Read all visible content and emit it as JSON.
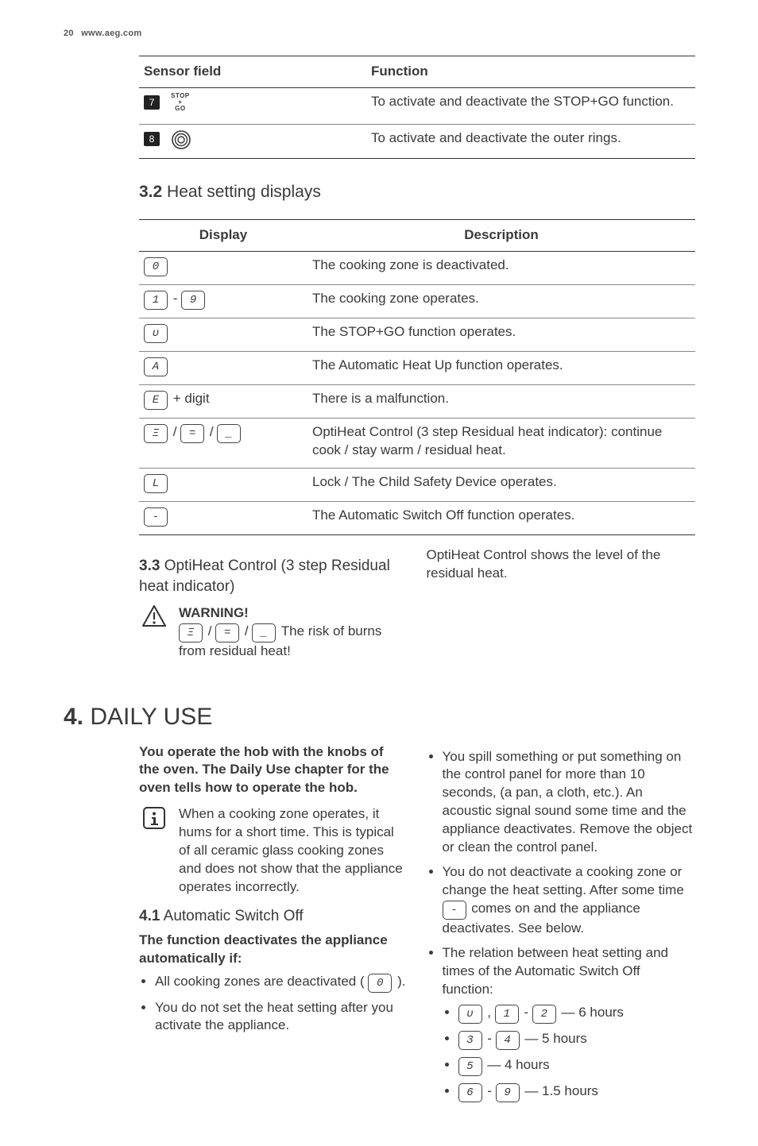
{
  "header": {
    "page_number": "20",
    "site": "www.aeg.com"
  },
  "sensor_table": {
    "col1": "Sensor field",
    "col2": "Function",
    "rows": [
      {
        "num": "7",
        "icon": "stop-go",
        "icon_text": "STOP\n+\nGO",
        "desc": "To activate and deactivate the STOP+GO function."
      },
      {
        "num": "8",
        "icon": "outer-ring",
        "desc": "To activate and deactivate the outer rings."
      }
    ]
  },
  "sec32": {
    "heading_num": "3.2",
    "heading_txt": "Heat setting displays",
    "col1": "Display",
    "col2": "Description",
    "rows": [
      {
        "disp": [
          {
            "t": "seg",
            "v": "0"
          }
        ],
        "desc": "The cooking zone is deactivated."
      },
      {
        "disp": [
          {
            "t": "seg",
            "v": "1"
          },
          {
            "t": "txt",
            "v": " - "
          },
          {
            "t": "seg",
            "v": "9"
          }
        ],
        "desc": "The cooking zone operates."
      },
      {
        "disp": [
          {
            "t": "seg",
            "v": "υ"
          }
        ],
        "desc": "The STOP+GO function operates."
      },
      {
        "disp": [
          {
            "t": "seg",
            "v": "A"
          }
        ],
        "desc": "The Automatic Heat Up function operates."
      },
      {
        "disp": [
          {
            "t": "seg",
            "v": "E"
          },
          {
            "t": "txt",
            "v": " + digit"
          }
        ],
        "desc": "There is a malfunction."
      },
      {
        "disp": [
          {
            "t": "seg",
            "v": "Ξ"
          },
          {
            "t": "txt",
            "v": " / "
          },
          {
            "t": "seg",
            "v": "="
          },
          {
            "t": "txt",
            "v": " / "
          },
          {
            "t": "seg",
            "v": "_"
          }
        ],
        "desc": "OptiHeat Control (3 step Residual heat indicator): continue cook / stay warm / residual heat."
      },
      {
        "disp": [
          {
            "t": "seg",
            "v": "L"
          }
        ],
        "desc": "Lock / The Child Safety Device operates."
      },
      {
        "disp": [
          {
            "t": "seg",
            "v": "-"
          }
        ],
        "desc": "The Automatic Switch Off function operates."
      }
    ]
  },
  "sec33": {
    "heading_num": "3.3",
    "heading_txt": "OptiHeat Control (3 step Residual heat indicator)",
    "warn_title": "WARNING!",
    "warn_segs": [
      {
        "t": "seg",
        "v": "Ξ"
      },
      {
        "t": "txt",
        "v": " / "
      },
      {
        "t": "seg",
        "v": "="
      },
      {
        "t": "txt",
        "v": " / "
      },
      {
        "t": "seg",
        "v": "_"
      }
    ],
    "warn_txt": " The risk of burns from residual heat!",
    "right_txt": "OptiHeat Control shows the level of the residual heat."
  },
  "chap4": {
    "num": "4.",
    "title": "DAILY USE",
    "intro": "You operate the hob with the knobs of the oven. The Daily Use chapter for the oven tells how to operate the hob.",
    "info_txt": "When a cooking zone operates, it hums for a short time. This is typical of all ceramic glass cooking zones and does not show that the appliance operates incorrectly.",
    "sec41": {
      "num": "4.1",
      "title": "Automatic Switch Off",
      "lead": "The function deactivates the appliance automatically if:",
      "left_items": [
        {
          "pre": "All cooking zones are deactivated ( ",
          "seg": "0",
          "post": " )."
        },
        {
          "txt": "You do not set the heat setting after you activate the appliance."
        }
      ],
      "right_items": [
        {
          "txt": "You spill something or put something on the control panel for more than 10 seconds, (a pan, a cloth, etc.). An acoustic signal sound some time and the appliance deactivates. Remove the object or clean the control panel."
        },
        {
          "pre": "You do not deactivate a cooking zone or change the heat setting. After some time ",
          "seg": "-",
          "post": " comes on and the appliance deactivates. See below."
        },
        {
          "txt": "The relation between heat setting and times of the Automatic Switch Off function:",
          "sub": [
            {
              "parts": [
                {
                  "t": "seg",
                  "v": "υ"
                },
                {
                  "t": "txt",
                  "v": " , "
                },
                {
                  "t": "seg",
                  "v": "1"
                },
                {
                  "t": "txt",
                  "v": " - "
                },
                {
                  "t": "seg",
                  "v": "2"
                },
                {
                  "t": "txt",
                  "v": " — 6 hours"
                }
              ]
            },
            {
              "parts": [
                {
                  "t": "seg",
                  "v": "3"
                },
                {
                  "t": "txt",
                  "v": " - "
                },
                {
                  "t": "seg",
                  "v": "4"
                },
                {
                  "t": "txt",
                  "v": " — 5 hours"
                }
              ]
            },
            {
              "parts": [
                {
                  "t": "seg",
                  "v": "5"
                },
                {
                  "t": "txt",
                  "v": " — 4 hours"
                }
              ]
            },
            {
              "parts": [
                {
                  "t": "seg",
                  "v": "6"
                },
                {
                  "t": "txt",
                  "v": " - "
                },
                {
                  "t": "seg",
                  "v": "9"
                },
                {
                  "t": "txt",
                  "v": " — 1.5 hours"
                }
              ]
            }
          ]
        }
      ]
    }
  }
}
